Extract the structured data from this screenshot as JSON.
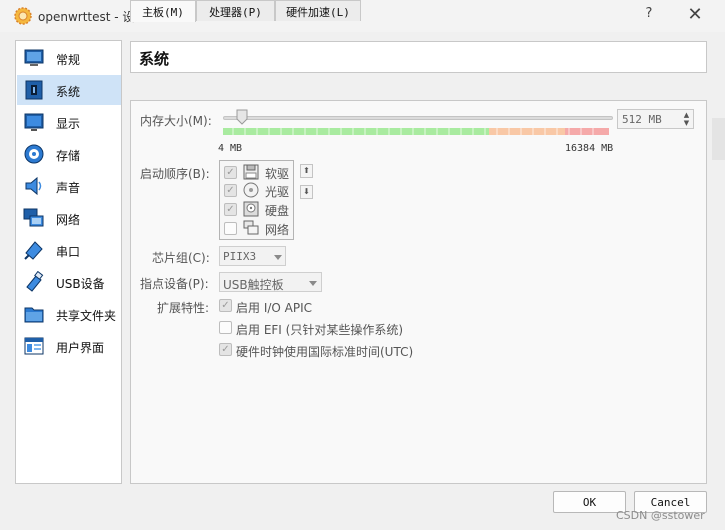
{
  "window": {
    "title": "openwrttest - 设置",
    "help_label": "?",
    "close_label": "✕"
  },
  "sidebar": {
    "items": [
      {
        "label": "常规",
        "icon": "general-icon"
      },
      {
        "label": "系统",
        "icon": "system-icon",
        "selected": true
      },
      {
        "label": "显示",
        "icon": "display-icon"
      },
      {
        "label": "存储",
        "icon": "storage-icon"
      },
      {
        "label": "声音",
        "icon": "audio-icon"
      },
      {
        "label": "网络",
        "icon": "network-icon"
      },
      {
        "label": "串口",
        "icon": "serial-port-icon"
      },
      {
        "label": "USB设备",
        "icon": "usb-icon"
      },
      {
        "label": "共享文件夹",
        "icon": "shared-folder-icon"
      },
      {
        "label": "用户界面",
        "icon": "user-interface-icon"
      }
    ]
  },
  "header": {
    "title": "系统"
  },
  "tabs": [
    {
      "label": "主板(M)",
      "active": true
    },
    {
      "label": "处理器(P)"
    },
    {
      "label": "硬件加速(L)"
    }
  ],
  "motherboard": {
    "memory": {
      "label": "内存大小(M):",
      "value": "512 MB",
      "min_label": "4 MB",
      "max_label": "16384 MB",
      "value_mb": 512,
      "min_mb": 4,
      "max_mb": 16384
    },
    "boot_order": {
      "label": "启动顺序(B):",
      "items": [
        {
          "label": "软驱",
          "checked": true,
          "icon": "floppy-icon"
        },
        {
          "label": "光驱",
          "checked": true,
          "icon": "optical-disc-icon"
        },
        {
          "label": "硬盘",
          "checked": true,
          "icon": "hard-disk-icon"
        },
        {
          "label": "网络",
          "checked": false,
          "icon": "network-boot-icon"
        }
      ],
      "up_label": "⬆",
      "down_label": "⬇"
    },
    "chipset": {
      "label": "芯片组(C):",
      "value": "PIIX3"
    },
    "pointing": {
      "label": "指点设备(P):",
      "value": "USB触控板"
    },
    "extended": {
      "label": "扩展特性:",
      "items": [
        {
          "label": "启用 I/O APIC",
          "checked": true,
          "disabled": true
        },
        {
          "label": "启用 EFI (只针对某些操作系统)",
          "checked": false,
          "disabled": false
        },
        {
          "label": "硬件时钟使用国际标准时间(UTC)",
          "checked": true,
          "disabled": true
        }
      ]
    }
  },
  "buttons": {
    "ok": "OK",
    "cancel": "Cancel"
  },
  "watermark": "CSDN @sstower",
  "colors": {
    "selection": "#cfe3f7",
    "scale_green": "#a9eba0",
    "scale_orange": "#f9c8a6",
    "scale_red": "#f5a9a9"
  }
}
